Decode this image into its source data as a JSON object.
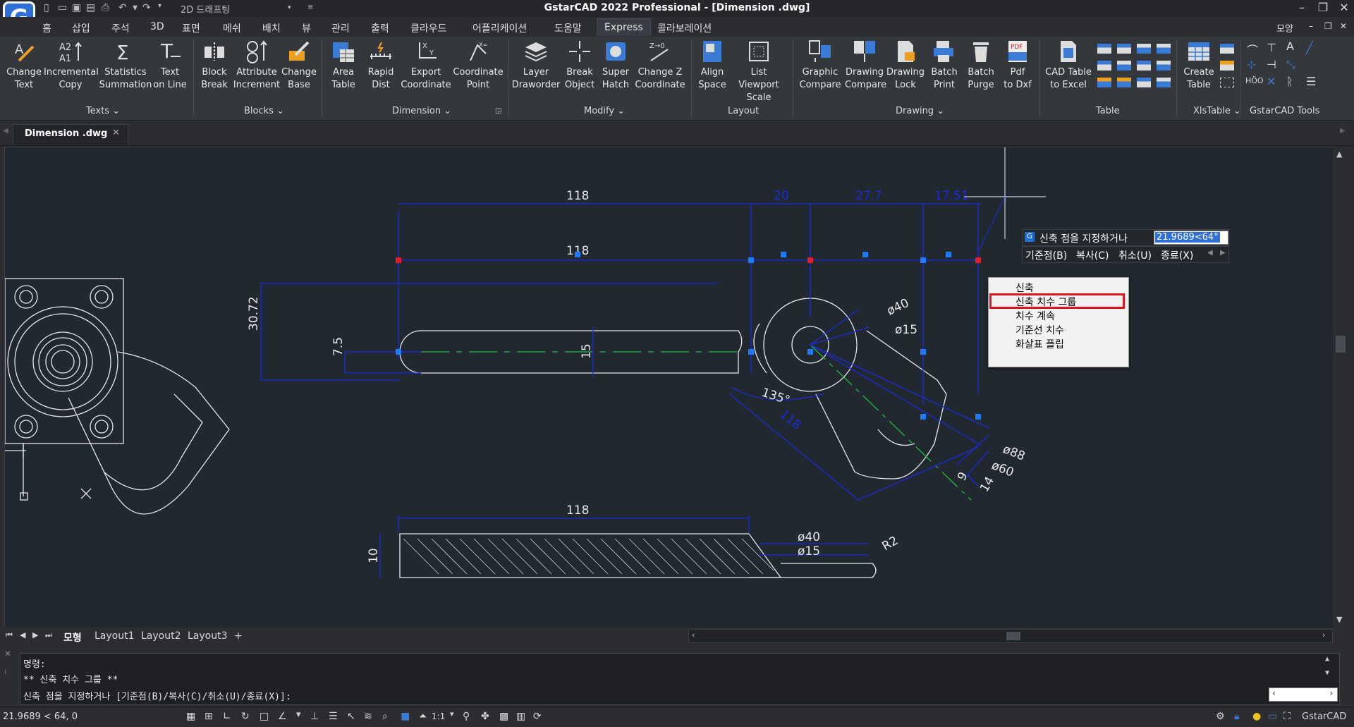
{
  "window": {
    "title": "GstarCAD 2022 Professional - [Dimension .dwg]",
    "workspace": "2D 드래프팅",
    "view_menu": "모양"
  },
  "menus": [
    "홈",
    "삽입",
    "주석",
    "3D",
    "표면",
    "메쉬",
    "배치",
    "뷰",
    "관리",
    "출력",
    "클라우드",
    "어플리케이션",
    "도움말",
    "Express",
    "콜라보레이션"
  ],
  "ribbon": {
    "groups": {
      "texts": "Texts",
      "blocks": "Blocks",
      "dimension": "Dimension",
      "modify": "Modify",
      "layout": "Layout",
      "drawing": "Drawing",
      "table": "Table",
      "xlstable": "XlsTable",
      "tools": "GstarCAD Tools"
    },
    "buttons": {
      "change_text": [
        "Change",
        "Text"
      ],
      "incremental_copy": [
        "Incremental",
        "Copy"
      ],
      "statistics_summation": [
        "Statistics",
        "Summation"
      ],
      "text_on_line": [
        "Text",
        "on Line"
      ],
      "block_break": [
        "Block",
        "Break"
      ],
      "attribute_increment": [
        "Attribute",
        "Increment"
      ],
      "change_base": [
        "Change",
        "Base"
      ],
      "area_table": [
        "Area",
        "Table"
      ],
      "rapid_dist": [
        "Rapid",
        "Dist"
      ],
      "export_coordinate": [
        "Export",
        "Coordinate"
      ],
      "coordinate_point": [
        "Coordinate",
        "Point"
      ],
      "layer_draworder": [
        "Layer",
        "Draworder"
      ],
      "break_object": [
        "Break",
        "Object"
      ],
      "super_hatch": [
        "Super",
        "Hatch"
      ],
      "change_z_coordinate": [
        "Change Z",
        "Coordinate"
      ],
      "align_space": [
        "Align",
        "Space"
      ],
      "list_viewport_scale": [
        "List Viewport",
        "Scale"
      ],
      "graphic_compare": [
        "Graphic",
        "Compare"
      ],
      "drawing_compare": [
        "Drawing",
        "Compare"
      ],
      "drawing_lock": [
        "Drawing",
        "Lock"
      ],
      "batch_print": [
        "Batch",
        "Print"
      ],
      "batch_purge": [
        "Batch",
        "Purge"
      ],
      "pdf_to_dxf": [
        "Pdf",
        "to Dxf"
      ],
      "cad_table_to_excel": [
        "CAD Table",
        "to Excel"
      ],
      "create_table": [
        "Create",
        "Table"
      ]
    }
  },
  "doc_tab": "Dimension .dwg",
  "drawing": {
    "dims": [
      "118",
      "20",
      "27.7",
      "17.51",
      "118",
      "30.72",
      "7.5",
      "15",
      "ø40",
      "ø15",
      "135°",
      "ø88",
      "ø60",
      "9",
      "14",
      "118",
      "10",
      "ø40",
      "ø15",
      "R2"
    ],
    "ghost_label": "118"
  },
  "dynamic_prompt": {
    "label": "신축 점을 지정하거나",
    "value": "21.9689<64°",
    "options": [
      "기준점(B)",
      "복사(C)",
      "취소(U)",
      "종료(X)"
    ]
  },
  "context_menu": {
    "items": [
      "신축",
      "신축 치수 그룹",
      "치수 계속",
      "기준선 치수",
      "화살표 플립"
    ],
    "highlighted_index": 1
  },
  "layout_tabs": [
    "모형",
    "Layout1",
    "Layout2",
    "Layout3",
    "+"
  ],
  "command_lines": [
    "명령:",
    "** 신축 치수 그룹 **",
    "신축 점을 지정하거나 [기준점(B)/복사(C)/취소(U)/종료(X)]:"
  ],
  "status": {
    "coordinates": "21.9689 < 64, 0",
    "scale": "1:1",
    "app": "GstarCAD"
  },
  "colors": {
    "canvas_bg": "#212830",
    "dimension": "#1a2bd8",
    "geometry": "#ffffff",
    "centerline": "#1fbf3a",
    "grip": "#1e7bff",
    "hot_grip": "#e01e2a",
    "highlight_border": "#e0161f"
  }
}
